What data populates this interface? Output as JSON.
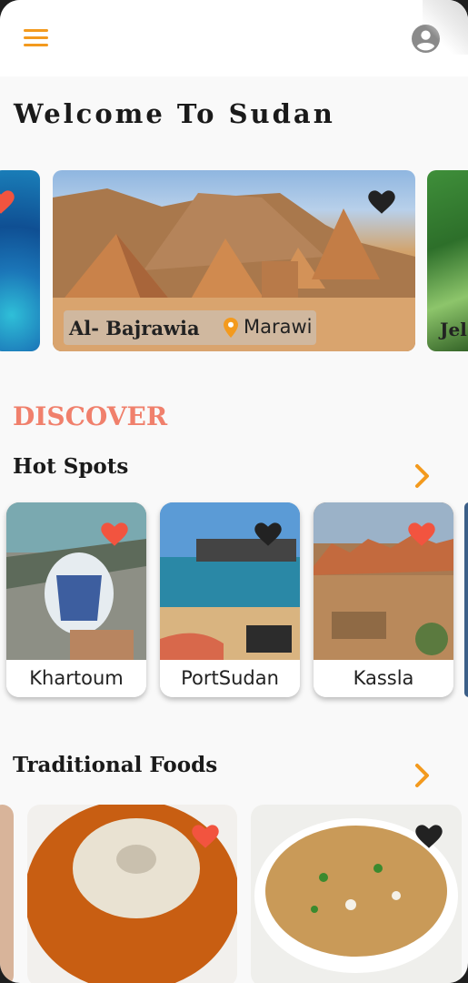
{
  "header": {
    "menu_icon": "menu-icon",
    "account_icon": "account-circle-icon",
    "accent": "#f39a1e"
  },
  "welcome_title": "Welcome To Sudan",
  "featured": {
    "main": {
      "name": "Al- Bajrawia",
      "location": "Marawi",
      "favorited": true
    },
    "right_partial_name": "Jel",
    "left_partial_favorited": true
  },
  "discover_label": "DISCOVER",
  "hot_spots": {
    "title": "Hot Spots",
    "items": [
      {
        "label": "Khartoum",
        "heart_color": "#f2543f"
      },
      {
        "label": "PortSudan",
        "heart_color": "#222222"
      },
      {
        "label": "Kassla",
        "heart_color": "#f2543f"
      }
    ]
  },
  "traditional_foods": {
    "title": "Traditional Foods",
    "items": [
      {
        "heart_color": "#f2543f"
      },
      {
        "heart_color": "#222222"
      }
    ]
  }
}
